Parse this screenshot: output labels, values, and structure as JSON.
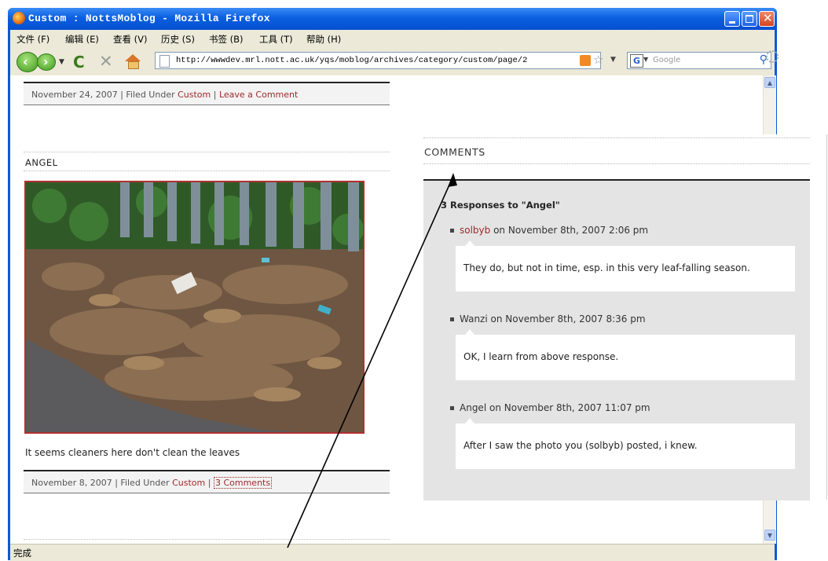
{
  "window": {
    "title": "Custom : NottsMoblog - Mozilla Firefox"
  },
  "menu": [
    "文件 (F)",
    "编辑 (E)",
    "查看 (V)",
    "历史 (S)",
    "书签 (B)",
    "工具 (T)",
    "帮助 (H)"
  ],
  "toolbar": {
    "url": "http://wwwdev.mrl.nott.ac.uk/yqs/moblog/archives/category/custom/page/2",
    "search_engine": "G",
    "search_placeholder": "Google"
  },
  "status": "完成",
  "posts": [
    {
      "date": "November 24, 2007",
      "filed_prefix": "Filed Under",
      "category": "Custom",
      "comment_link": "Leave a Comment"
    },
    {
      "title": "ANGEL",
      "caption": "It seems cleaners here don't clean the leaves",
      "date": "November 8, 2007",
      "filed_prefix": "Filed Under",
      "category": "Custom",
      "comment_link": "3 Comments"
    }
  ],
  "comments_panel": {
    "title": "COMMENTS",
    "responses_heading": "3 Responses to \"Angel\"",
    "comments": [
      {
        "author": "solbyb",
        "date": "on November 8th, 2007 2:06 pm",
        "text": "They do, but not in time, esp. in this very leaf-falling season."
      },
      {
        "author": "Wanzi",
        "date": "on November 8th, 2007 8:36 pm",
        "text": "OK, I learn from above response."
      },
      {
        "author": "Angel",
        "date": "on November 8th, 2007 11:07 pm",
        "text": "After I saw the photo you (solbyb) posted, i knew."
      }
    ]
  },
  "colors": {
    "link": "#9b2a2a",
    "titlebar": "#0a5fe0",
    "panel": "#e4e4e4"
  }
}
